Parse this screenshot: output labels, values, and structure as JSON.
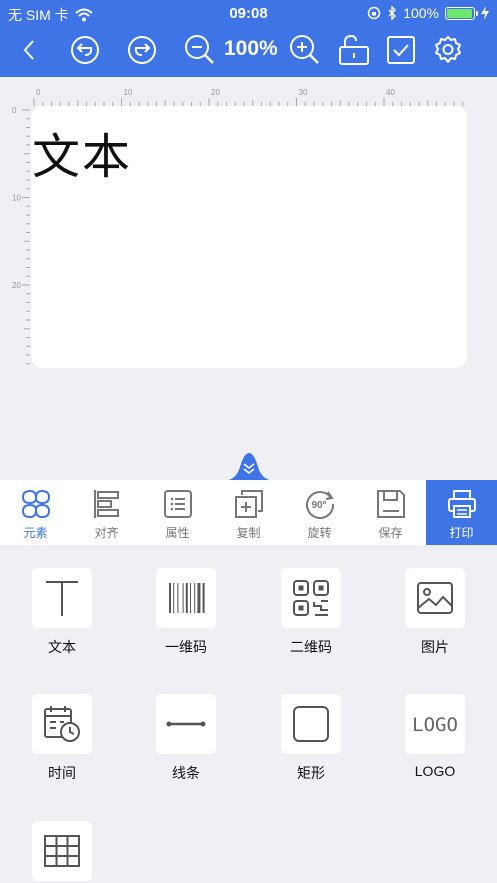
{
  "status_bar": {
    "carrier": "无 SIM 卡",
    "time": "09:08",
    "battery_percent": "100%",
    "battery_level": 1.0
  },
  "toolbar": {
    "zoom_level": "100%",
    "icons": [
      "back-icon",
      "undo-icon",
      "redo-icon",
      "zoom-out-icon",
      "zoom-in-icon",
      "unlock-icon",
      "checkbox-icon",
      "settings-icon"
    ]
  },
  "ruler": {
    "horizontal_ticks": [
      "0",
      "10",
      "20",
      "30",
      "40"
    ],
    "vertical_ticks": [
      "0",
      "10",
      "20"
    ]
  },
  "label": {
    "text": "文本"
  },
  "tabs": [
    {
      "label": "元素",
      "icon": "elements-icon"
    },
    {
      "label": "对齐",
      "icon": "align-icon"
    },
    {
      "label": "属性",
      "icon": "properties-icon"
    },
    {
      "label": "复制",
      "icon": "copy-icon"
    },
    {
      "label": "旋转",
      "icon": "rotate-90-icon",
      "icon_text": "90°"
    },
    {
      "label": "保存",
      "icon": "save-icon"
    },
    {
      "label": "打印",
      "icon": "printer-icon"
    }
  ],
  "elements": [
    {
      "label": "文本",
      "icon": "text-icon"
    },
    {
      "label": "一维码",
      "icon": "barcode-icon"
    },
    {
      "label": "二维码",
      "icon": "qrcode-icon"
    },
    {
      "label": "图片",
      "icon": "image-icon"
    },
    {
      "label": "时间",
      "icon": "calendar-clock-icon"
    },
    {
      "label": "线条",
      "icon": "line-icon"
    },
    {
      "label": "矩形",
      "icon": "rectangle-icon"
    },
    {
      "label": "LOGO",
      "icon": "logo-icon",
      "icon_text": "LOGO"
    },
    {
      "label": "表格",
      "icon": "table-icon"
    }
  ],
  "colors": {
    "accent": "#3e74e6",
    "background": "#efeff4",
    "battery_fill": "#6ee76e"
  }
}
